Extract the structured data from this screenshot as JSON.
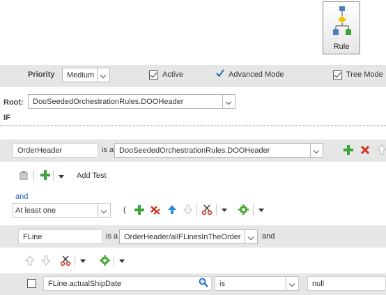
{
  "rule_button": {
    "label": "Rule",
    "icon": "rule-flow-icon"
  },
  "header": {
    "priority_label": "Priority",
    "priority_value": "Medium",
    "active_label": "Active",
    "active_checked": true,
    "advanced_mode_label": "Advanced Mode",
    "advanced_mode_checked": true,
    "tree_mode_label": "Tree Mode",
    "tree_mode_checked": true
  },
  "root": {
    "label": "Root:",
    "value": "DooSeededOrchestrationRules.DOOHeader"
  },
  "if_label": "IF",
  "pattern1": {
    "variable": "OrderHeader",
    "is_a_label": "is a",
    "fact_type": "DooSeededOrchestrationRules.DOOHeader"
  },
  "add_test_label": "Add Test",
  "and_label": "and",
  "quantifier": {
    "value": "At least one",
    "open_paren": "("
  },
  "pattern2": {
    "variable": "FLine",
    "is_a_label": "is a",
    "fact_type": "OrderHeader/allFLinesInTheOrder",
    "and_label": "and"
  },
  "test_row": {
    "checked": false,
    "left_operand": "FLine.actualShipDate",
    "operator": "is",
    "right_operand": "null"
  },
  "colors": {
    "band": "#e6e6e6",
    "add": "#3aa33a",
    "delete": "#d0321f",
    "link": "#1a5fb4"
  }
}
